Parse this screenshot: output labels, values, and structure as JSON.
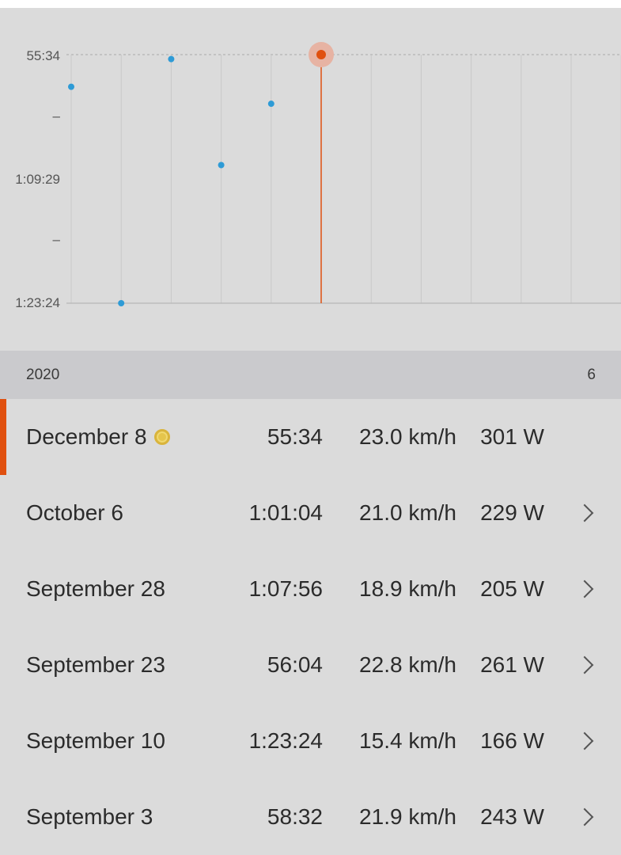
{
  "chart_data": {
    "type": "scatter",
    "y_axis_reversed": true,
    "yticks": [
      "55:34",
      "–",
      "1:09:29",
      "–",
      "1:23:24"
    ],
    "points": [
      {
        "label": "",
        "value": "59:10"
      },
      {
        "label": "September 10",
        "value": "1:23:24"
      },
      {
        "label": "September 23",
        "value": "56:04"
      },
      {
        "label": "September 28",
        "value": "1:07:56"
      },
      {
        "label": "October 6",
        "value": "1:01:04"
      },
      {
        "label": "December 8",
        "value": "55:34",
        "selected": true
      }
    ],
    "colors": {
      "point": "#2e9bd6",
      "selected": "#e0500f",
      "selected_halo": "#e7b3a3",
      "gridline": "#c8c8c8"
    }
  },
  "year_header": {
    "year": "2020",
    "count": "6"
  },
  "rides": [
    {
      "date": "December 8",
      "time": "55:34",
      "speed": "23.0 km/h",
      "power": "301 W",
      "medal": true,
      "selected": true
    },
    {
      "date": "October 6",
      "time": "1:01:04",
      "speed": "21.0 km/h",
      "power": "229 W"
    },
    {
      "date": "September 28",
      "time": "1:07:56",
      "speed": "18.9 km/h",
      "power": "205 W"
    },
    {
      "date": "September 23",
      "time": "56:04",
      "speed": "22.8 km/h",
      "power": "261 W"
    },
    {
      "date": "September 10",
      "time": "1:23:24",
      "speed": "15.4 km/h",
      "power": "166 W"
    },
    {
      "date": "September 3",
      "time": "58:32",
      "speed": "21.9 km/h",
      "power": "243 W"
    }
  ]
}
